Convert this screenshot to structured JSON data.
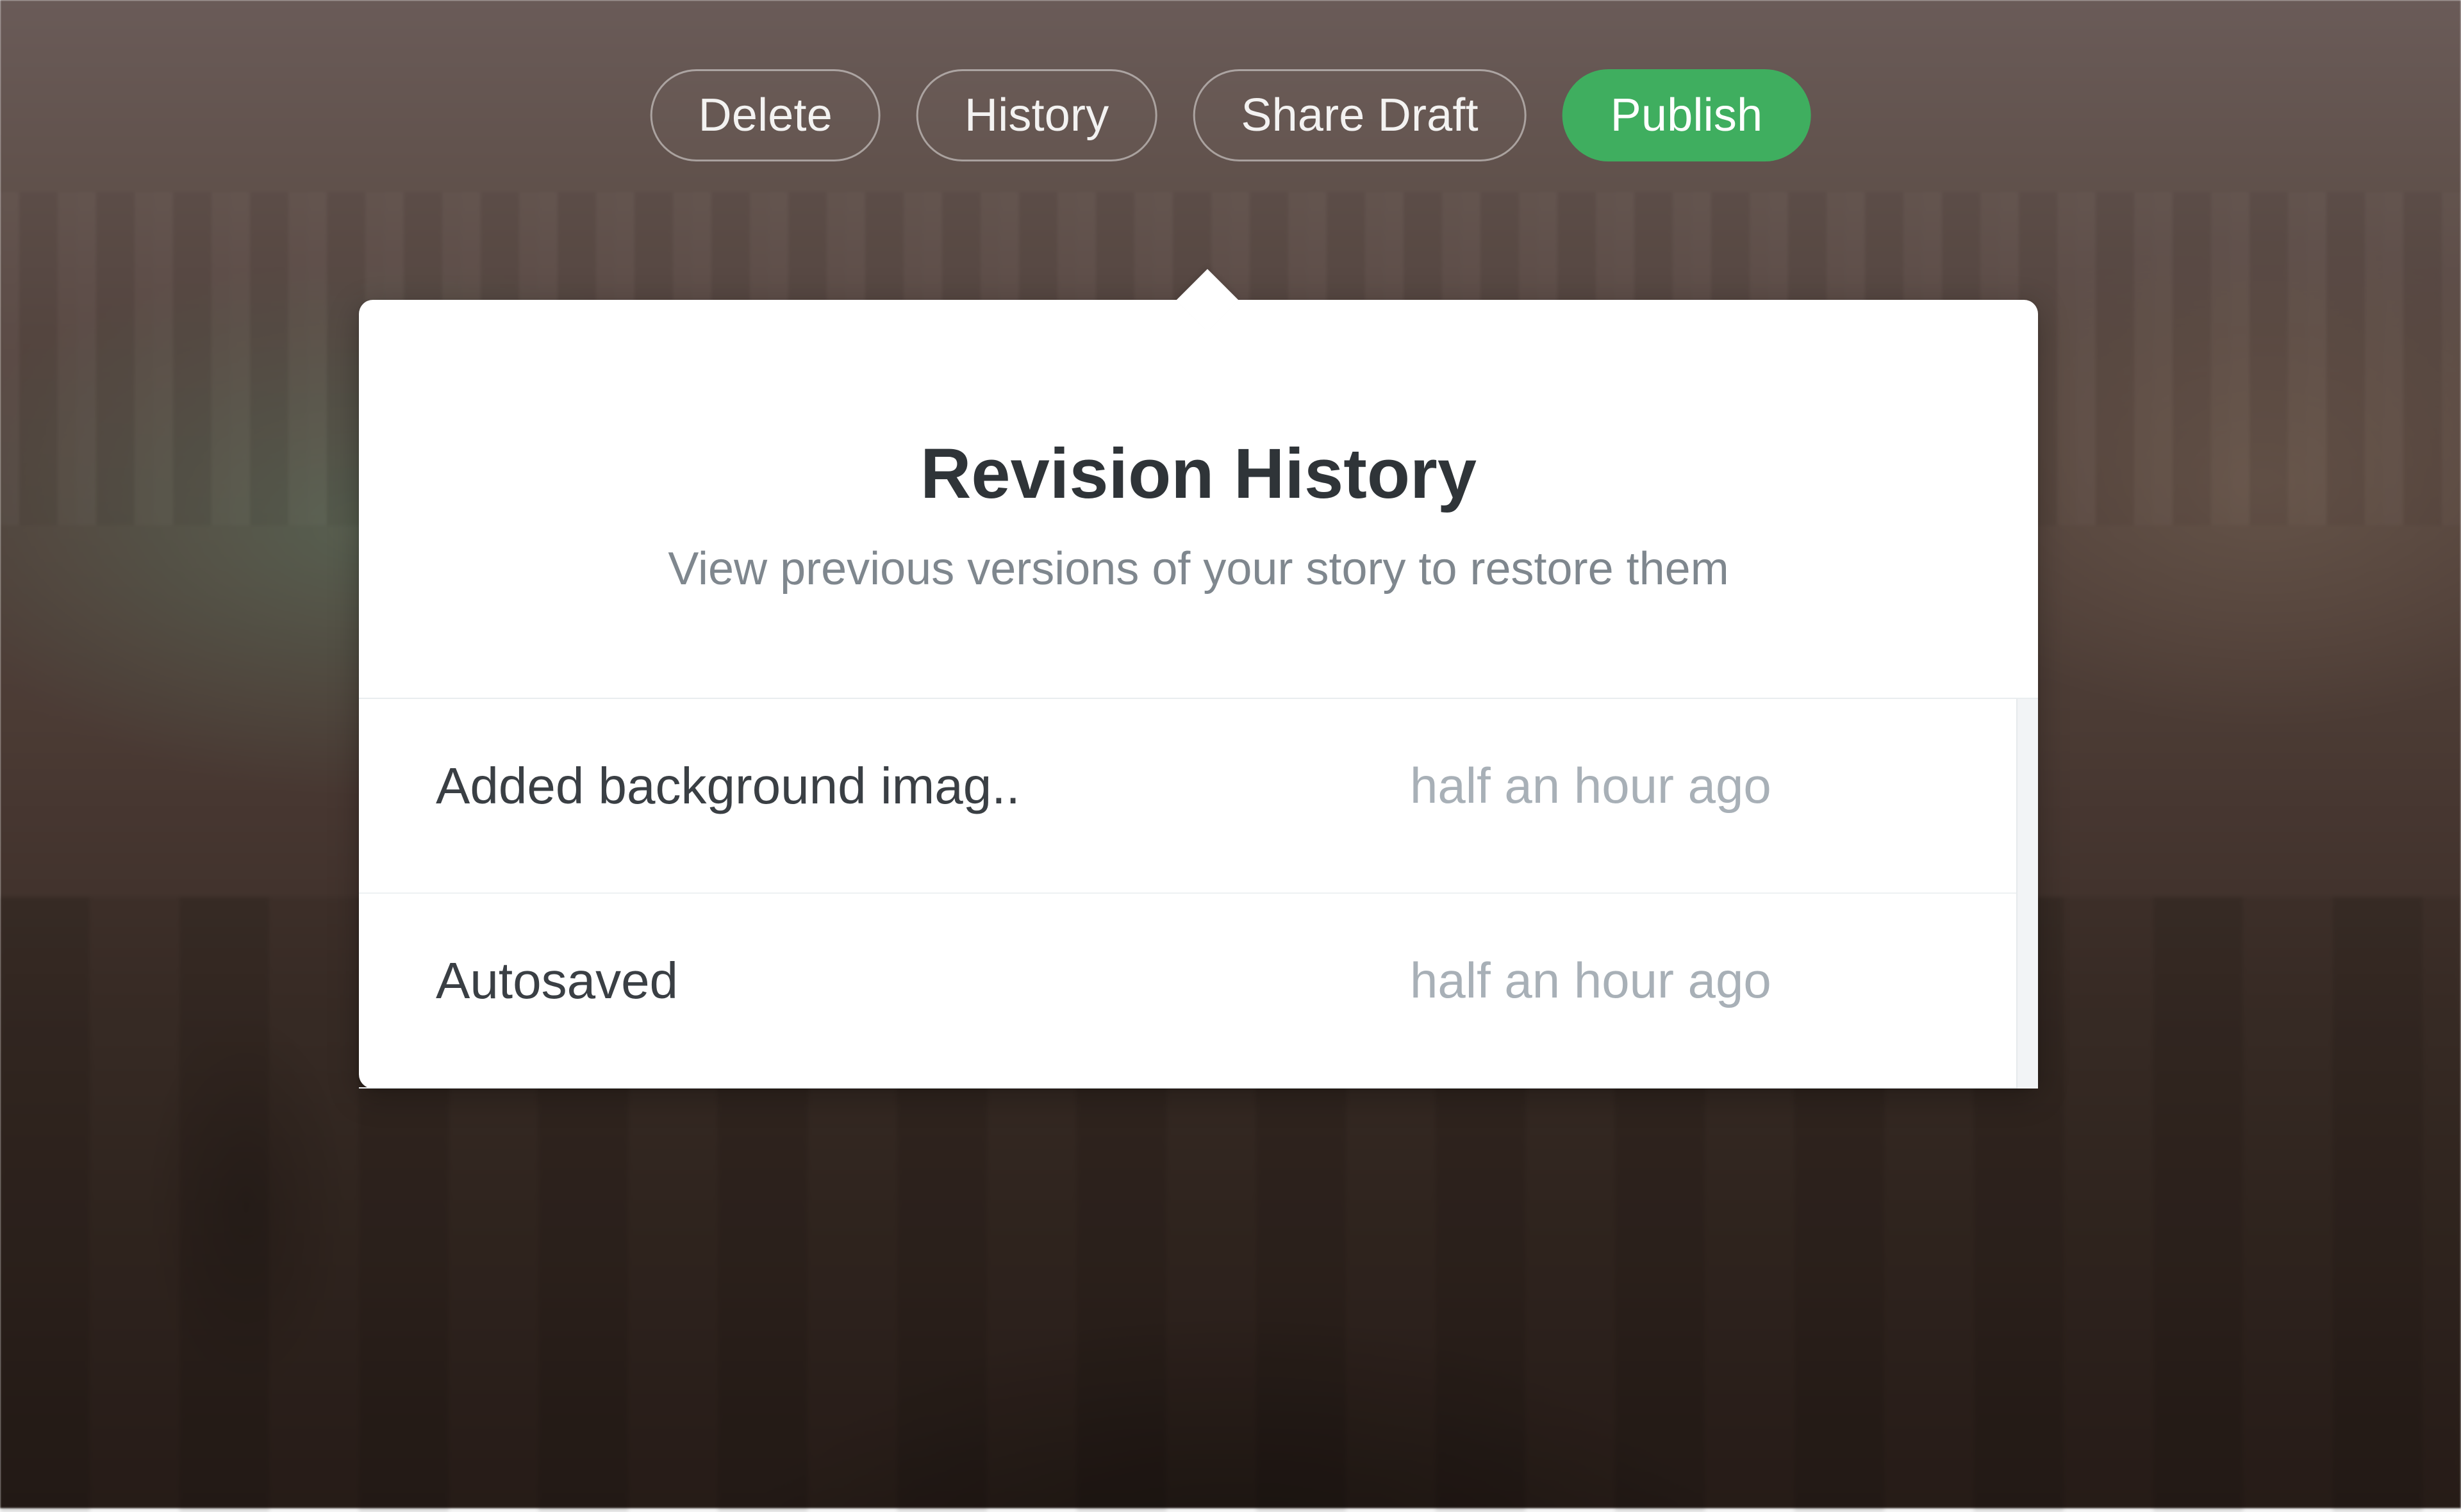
{
  "toolbar": {
    "delete_label": "Delete",
    "history_label": "History",
    "share_draft_label": "Share Draft",
    "publish_label": "Publish"
  },
  "popover": {
    "title": "Revision History",
    "subtitle": "View previous versions of your story to restore them"
  },
  "revisions": [
    {
      "label": "Added background imag..",
      "time": "half an hour ago"
    },
    {
      "label": "Autosaved",
      "time": "half an hour ago"
    }
  ],
  "colors": {
    "publish_bg": "#3fae5f",
    "text_primary": "#2f3438",
    "text_muted": "#a8b0b7"
  }
}
